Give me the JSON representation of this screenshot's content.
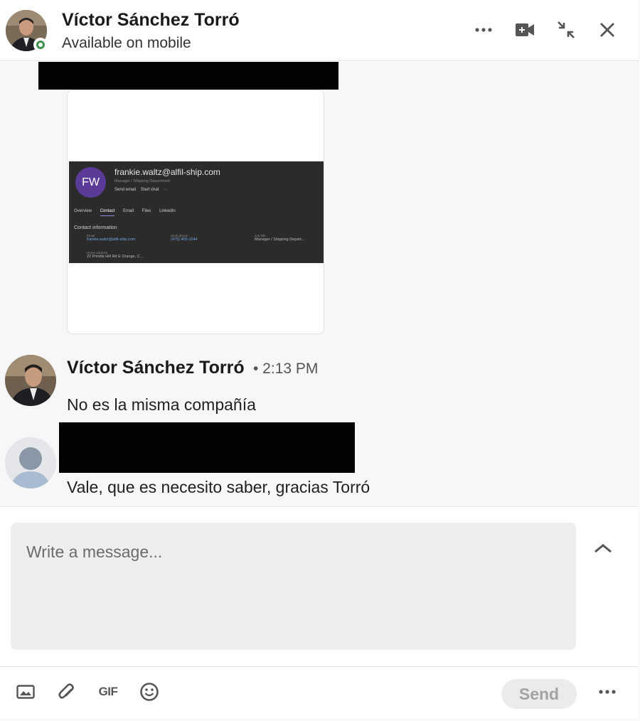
{
  "header": {
    "name": "Víctor Sánchez Torró",
    "status": "Available on mobile",
    "icons": [
      "more-options-icon",
      "video-call-icon",
      "minimize-icon",
      "close-icon"
    ]
  },
  "attachment": {
    "initials": "FW",
    "email": "frankie.waltz@alfil-ship.com",
    "role": "Manager / Shipping Department",
    "actions": [
      "Send email",
      "Start chat",
      "···"
    ],
    "tabs": [
      "Overview",
      "Contact",
      "Email",
      "Files",
      "LinkedIn"
    ],
    "active_tab": "Contact",
    "section_title": "Contact information",
    "fields": [
      {
        "label": "Email",
        "value": "frankie.waltz@alfil-ship.com"
      },
      {
        "label": "Work phone",
        "value": "(475) 405-1044"
      },
      {
        "label": "Job title",
        "value": "Manager / Shipping Depart..."
      },
      {
        "label": "Home address",
        "value": "22 Prindle Hill Rd E Orange, C..."
      }
    ]
  },
  "messages": [
    {
      "sender": "Víctor Sánchez Torró",
      "time": "• 2:13 PM",
      "text": "No es la misma compañía"
    },
    {
      "sender": "",
      "text": "Vale, que es necesito saber, gracias Torró"
    }
  ],
  "composer": {
    "placeholder": "Write a message...",
    "value": ""
  },
  "footer": {
    "gif_label": "GIF",
    "send_label": "Send",
    "icons": [
      "image-icon",
      "attachment-icon",
      "gif-icon",
      "emoji-icon",
      "more-options-icon"
    ]
  },
  "colors": {
    "presence": "#3f8f4f",
    "avatar_fw": "#5b3b98",
    "redaction": "#030303"
  }
}
